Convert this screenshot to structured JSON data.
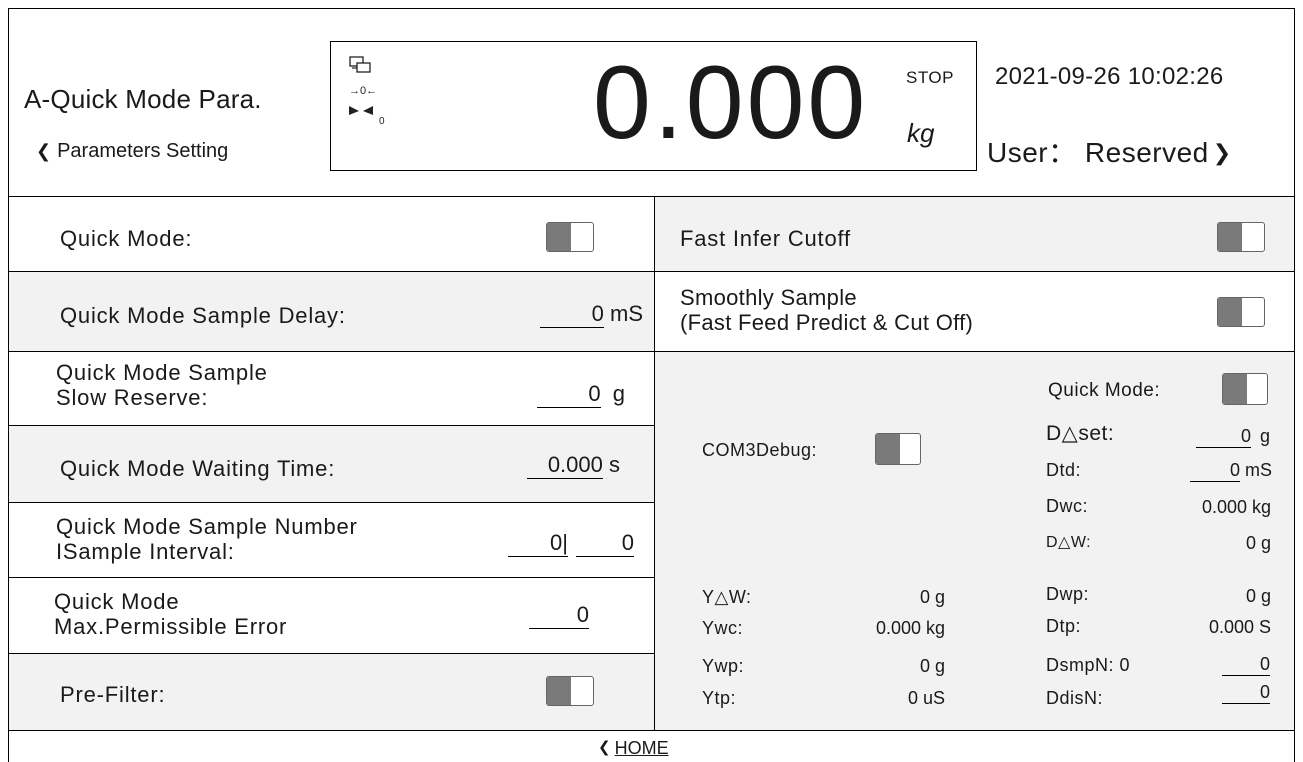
{
  "header": {
    "title": "A-Quick  Mode Para.",
    "back_label": "Parameters Setting",
    "datetime": "2021-09-26 10:02:26",
    "user_label": "User： Reserved"
  },
  "display": {
    "weight": "0.000",
    "status": "STOP",
    "unit": "kg",
    "status_icons": [
      "monitor-icon",
      "zero-icon",
      "stable-icon"
    ],
    "zero_indicator_value": "0"
  },
  "left_rows": [
    {
      "label": "Quick  Mode:",
      "toggle_on": false
    },
    {
      "label": "Quick  Mode  Sample  Delay:",
      "value": "0",
      "unit": "mS"
    },
    {
      "label_line1": "Quick  Mode  Sample",
      "label_line2": "Slow  Reserve:",
      "value": "0",
      "unit": "g"
    },
    {
      "label": "Quick  Mode  Waiting  Time:",
      "value": "0.000",
      "unit": "s"
    },
    {
      "label_line1": "Quick  Mode  Sample  Number",
      "label_line2": "ISample  Interval:",
      "value1": "0|",
      "value2": "0"
    },
    {
      "label_line1": "Quick  Mode",
      "label_line2": "Max.Permissible  Error",
      "value": "0"
    },
    {
      "label": "Pre-Filter:",
      "toggle_on": false
    }
  ],
  "right_rows": [
    {
      "label": "Fast  Infer  Cutoff",
      "toggle_on": false
    },
    {
      "label_line1": "Smoothly Sample",
      "label_line2": "(Fast Feed Predict & Cut Off)",
      "toggle_on": false
    }
  ],
  "debug": {
    "com3_label": "COM3Debug:",
    "quick_mode_label": "Quick  Mode:",
    "left_items": [
      {
        "label": "Y△W:",
        "value": "0  g"
      },
      {
        "label": "Ywc:",
        "value": "0.000  kg"
      },
      {
        "label": "Ywp:",
        "value": "0  g"
      },
      {
        "label": "Ytp:",
        "value": "0  uS"
      }
    ],
    "right_items": [
      {
        "label": "D△set:",
        "value": "0",
        "unit": "g"
      },
      {
        "label": "Dtd:",
        "value": "0",
        "unit": "mS"
      },
      {
        "label": "Dwc:",
        "value": "0.000  kg"
      },
      {
        "label": "D△W:",
        "value": "0  g"
      },
      {
        "label": "Dwp:",
        "value": "0  g"
      },
      {
        "label": "Dtp:",
        "value": "0.000 S"
      },
      {
        "label": "DsmpN:  0",
        "value": "0"
      },
      {
        "label": "DdisN:",
        "value": "0"
      }
    ]
  },
  "footer": {
    "home_label": "HOME"
  }
}
